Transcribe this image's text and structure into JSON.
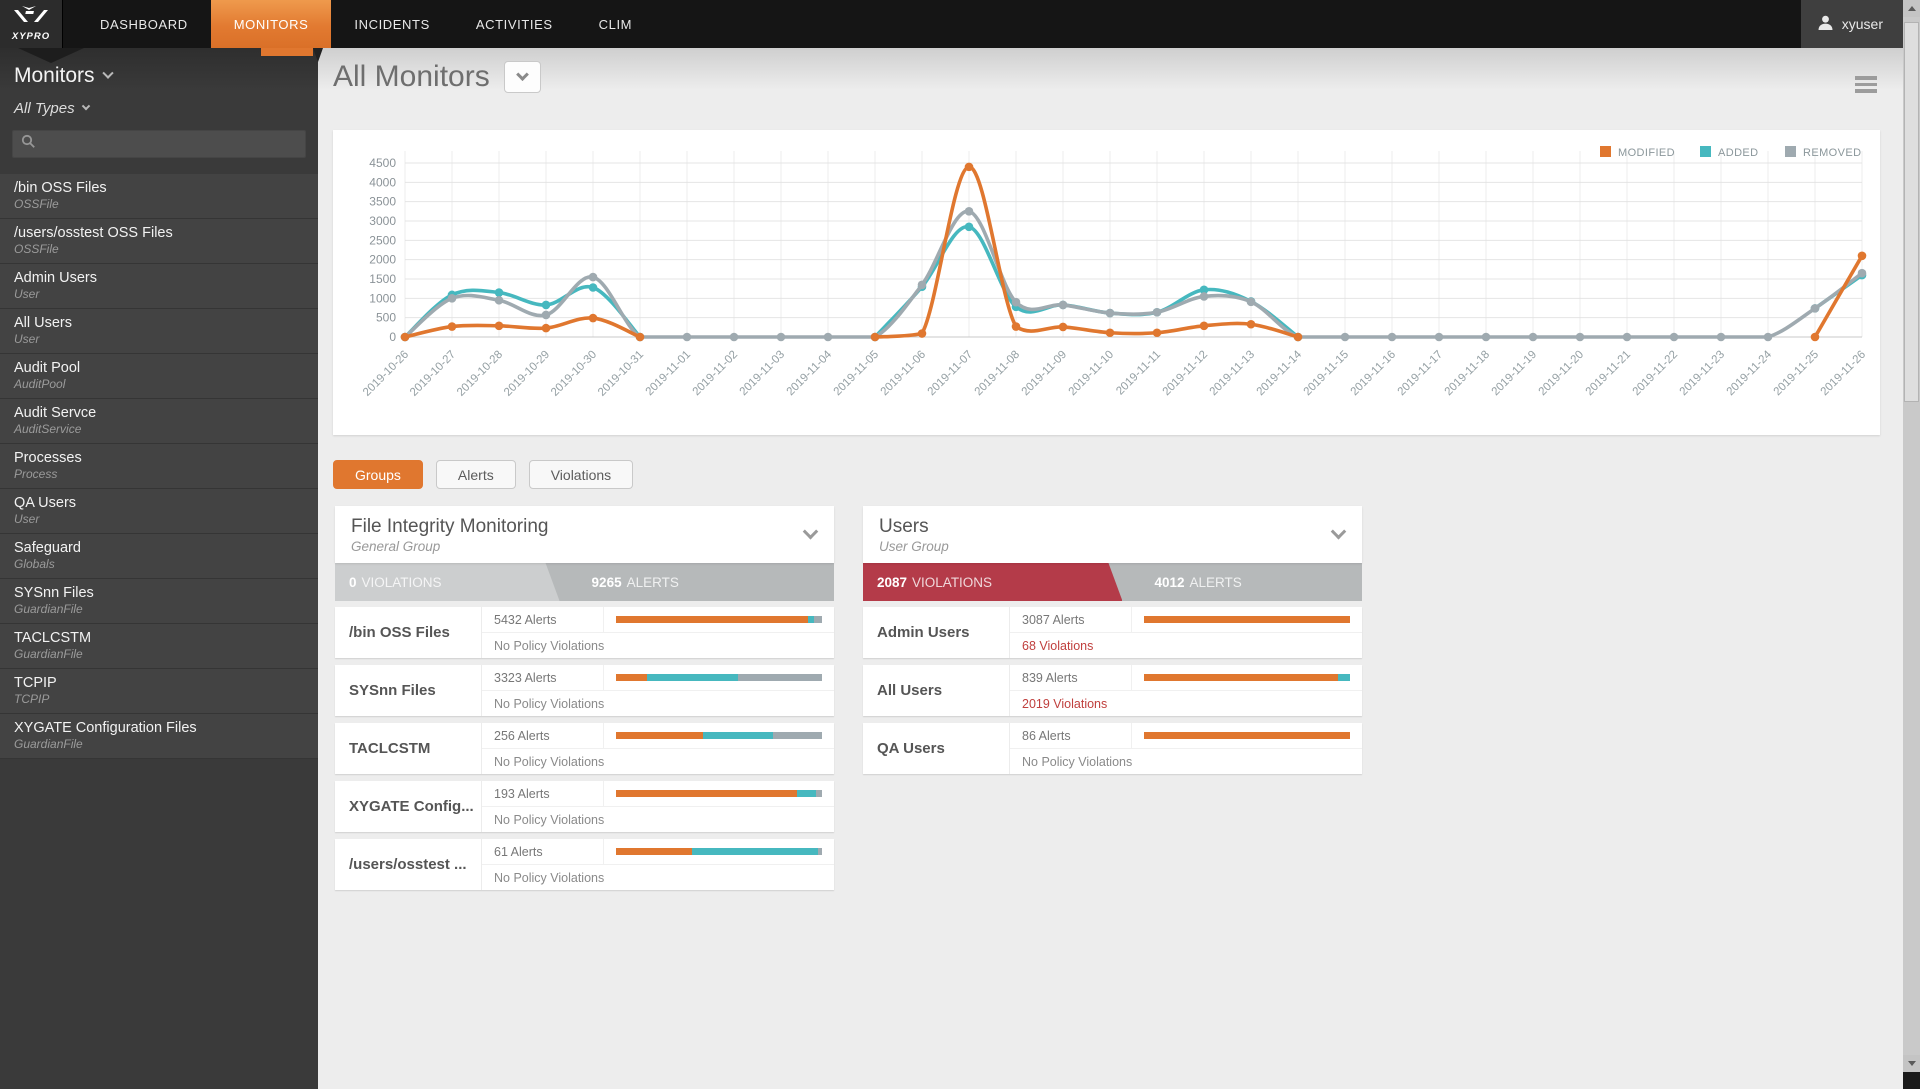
{
  "nav": {
    "brand": "XYPRO",
    "items": [
      {
        "label": "DASHBOARD",
        "active": false
      },
      {
        "label": "MONITORS",
        "active": true
      },
      {
        "label": "INCIDENTS",
        "active": false
      },
      {
        "label": "ACTIVITIES",
        "active": false
      },
      {
        "label": "CLIM",
        "active": false
      }
    ],
    "user": "xyuser"
  },
  "sidebar": {
    "title": "Monitors",
    "type_filter": "All Types",
    "search_placeholder": "",
    "monitors": [
      {
        "name": "/bin OSS Files",
        "type": "OSSFile"
      },
      {
        "name": "/users/osstest OSS Files",
        "type": "OSSFile"
      },
      {
        "name": "Admin Users",
        "type": "User"
      },
      {
        "name": "All Users",
        "type": "User"
      },
      {
        "name": "Audit Pool",
        "type": "AuditPool"
      },
      {
        "name": "Audit Servce",
        "type": "AuditService"
      },
      {
        "name": "Processes",
        "type": "Process"
      },
      {
        "name": "QA Users",
        "type": "User"
      },
      {
        "name": "Safeguard",
        "type": "Globals"
      },
      {
        "name": "SYSnn Files",
        "type": "GuardianFile"
      },
      {
        "name": "TACLCSTM",
        "type": "GuardianFile"
      },
      {
        "name": "TCPIP",
        "type": "TCPIP"
      },
      {
        "name": "XYGATE Configuration Files",
        "type": "GuardianFile"
      }
    ]
  },
  "main": {
    "title": "All Monitors",
    "tabs": [
      {
        "label": "Groups",
        "active": true
      },
      {
        "label": "Alerts",
        "active": false
      },
      {
        "label": "Violations",
        "active": false
      }
    ]
  },
  "colors": {
    "modified": "#e0772f",
    "added": "#46b8bf",
    "removed": "#9faab0",
    "violations_red": "#b43b49",
    "banner_gray": "#cccecf"
  },
  "chart_data": {
    "type": "line",
    "x": [
      "2019-10-26",
      "2019-10-27",
      "2019-10-28",
      "2019-10-29",
      "2019-10-30",
      "2019-10-31",
      "2019-11-01",
      "2019-11-02",
      "2019-11-03",
      "2019-11-04",
      "2019-11-05",
      "2019-11-06",
      "2019-11-07",
      "2019-11-08",
      "2019-11-09",
      "2019-11-10",
      "2019-11-11",
      "2019-11-12",
      "2019-11-13",
      "2019-11-14",
      "2019-11-15",
      "2019-11-16",
      "2019-11-17",
      "2019-11-18",
      "2019-11-19",
      "2019-11-20",
      "2019-11-21",
      "2019-11-22",
      "2019-11-23",
      "2019-11-24",
      "2019-11-25",
      "2019-11-26"
    ],
    "series": [
      {
        "name": "MODIFIED",
        "color": "#e0772f",
        "values": [
          0,
          270,
          290,
          230,
          490,
          0,
          null,
          null,
          null,
          null,
          0,
          90,
          4400,
          270,
          260,
          110,
          110,
          290,
          330,
          0,
          null,
          null,
          null,
          null,
          null,
          null,
          null,
          null,
          null,
          null,
          0,
          2100
        ]
      },
      {
        "name": "ADDED",
        "color": "#46b8bf",
        "values": [
          0,
          1090,
          1150,
          830,
          1280,
          0,
          null,
          null,
          null,
          null,
          0,
          1300,
          2850,
          780,
          830,
          620,
          640,
          1220,
          920,
          0,
          null,
          null,
          null,
          null,
          null,
          null,
          null,
          null,
          null,
          null,
          740,
          1600
        ]
      },
      {
        "name": "REMOVED",
        "color": "#9faab0",
        "values": [
          0,
          1000,
          950,
          570,
          1550,
          0,
          0,
          0,
          0,
          0,
          0,
          1350,
          3250,
          900,
          830,
          620,
          640,
          1050,
          910,
          0,
          0,
          0,
          0,
          0,
          0,
          0,
          0,
          0,
          0,
          0,
          740,
          1650
        ]
      }
    ],
    "ylim": [
      0,
      4500
    ],
    "yticks": [
      0,
      500,
      1000,
      1500,
      2000,
      2500,
      3000,
      3500,
      4000,
      4500
    ],
    "legend_position": "top-right",
    "grid": true
  },
  "groups": [
    {
      "title": "File Integrity Monitoring",
      "subtitle": "General Group",
      "violations_count": "0",
      "violations_label": "VIOLATIONS",
      "alerts_count": "9265",
      "alerts_label": "ALERTS",
      "violations_style": "gray",
      "violations_width": "45%",
      "rows": [
        {
          "name": "/bin OSS Files",
          "alerts": "5432 Alerts",
          "violations": "No Policy Violations",
          "violations_red": false,
          "bar": {
            "modified": 93,
            "added": 3,
            "removed": 4
          }
        },
        {
          "name": "SYSnn Files",
          "alerts": "3323 Alerts",
          "violations": "No Policy Violations",
          "violations_red": false,
          "bar": {
            "modified": 15,
            "added": 44,
            "removed": 41
          }
        },
        {
          "name": "TACLCSTM",
          "alerts": "256 Alerts",
          "violations": "No Policy Violations",
          "violations_red": false,
          "bar": {
            "modified": 42,
            "added": 34,
            "removed": 24
          }
        },
        {
          "name": "XYGATE Config...",
          "alerts": "193 Alerts",
          "violations": "No Policy Violations",
          "violations_red": false,
          "bar": {
            "modified": 88,
            "added": 9,
            "removed": 3
          }
        },
        {
          "name": "/users/osstest ...",
          "alerts": "61 Alerts",
          "violations": "No Policy Violations",
          "violations_red": false,
          "bar": {
            "modified": 37,
            "added": 61,
            "removed": 2
          }
        }
      ]
    },
    {
      "title": "Users",
      "subtitle": "User Group",
      "violations_count": "2087",
      "violations_label": "VIOLATIONS",
      "alerts_count": "4012",
      "alerts_label": "ALERTS",
      "violations_style": "red",
      "violations_width": "52%",
      "rows": [
        {
          "name": "Admin Users",
          "alerts": "3087 Alerts",
          "violations": "68 Violations",
          "violations_red": true,
          "bar": {
            "modified": 100,
            "added": 0,
            "removed": 0
          }
        },
        {
          "name": "All Users",
          "alerts": "839 Alerts",
          "violations": "2019 Violations",
          "violations_red": true,
          "bar": {
            "modified": 94,
            "added": 6,
            "removed": 0
          }
        },
        {
          "name": "QA Users",
          "alerts": "86 Alerts",
          "violations": "No Policy Violations",
          "violations_red": false,
          "bar": {
            "modified": 100,
            "added": 0,
            "removed": 0
          }
        }
      ]
    }
  ]
}
